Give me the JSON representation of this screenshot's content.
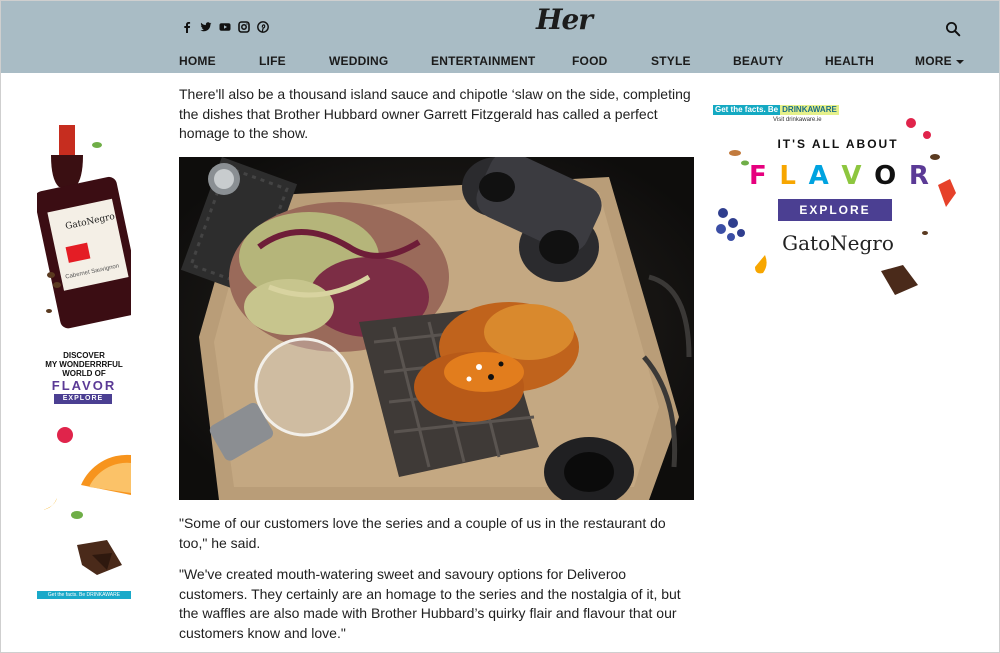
{
  "brand": {
    "logo": "Her"
  },
  "social": {
    "facebook": "facebook-icon",
    "twitter": "twitter-icon",
    "youtube": "youtube-icon",
    "instagram": "instagram-icon",
    "pinterest": "pinterest-icon"
  },
  "nav": {
    "items": [
      {
        "label": "HOME"
      },
      {
        "label": "LIFE"
      },
      {
        "label": "WEDDING"
      },
      {
        "label": "ENTERTAINMENT"
      },
      {
        "label": "FOOD"
      },
      {
        "label": "STYLE"
      },
      {
        "label": "BEAUTY"
      },
      {
        "label": "HEALTH"
      },
      {
        "label": "MORE"
      }
    ]
  },
  "article": {
    "intro": "There'll also be a thousand island sauce and chipotle ‘slaw on the side, completing the dishes that Brother Hubbard owner Garrett Fitzgerald has called a perfect homage to the show.",
    "quote1": "\"Some of our customers love the series and a couple of us in the restaurant do too,\" he said.",
    "quote2": "\"We've created mouth-watering sweet and savoury options for Deliveroo customers. They certainly are an homage to the series and the nostalgia of it, but the waffles are also made with Brother Hubbard’s quirky flair and flavour that our customers know and love.\""
  },
  "ad_left": {
    "bottle_label": "GatoNegro",
    "bottle_sub": "Cabernet Sauvignon",
    "line1": "DISCOVER",
    "line2": "MY WONDERRRFUL",
    "line3": "WORLD OF",
    "flavor": "FLAVOR",
    "explore": "EXPLORE",
    "footer": "Get the facts. Be DRINKAWARE"
  },
  "ad_right": {
    "drinkaware_prefix": "Get the facts. Be",
    "drinkaware": "DRINKAWARE",
    "drinkaware_url": "Visit drinkaware.ie",
    "tagline": "IT'S ALL ABOUT",
    "flavor_letters": [
      "F",
      "L",
      "A",
      "V",
      "O",
      "R"
    ],
    "flavor_colors": [
      "#e6007e",
      "#f7a600",
      "#00a3e0",
      "#8dc63f",
      "#111111",
      "#5b3a96"
    ],
    "explore": "EXPLORE",
    "brand": "GatoNegro"
  }
}
